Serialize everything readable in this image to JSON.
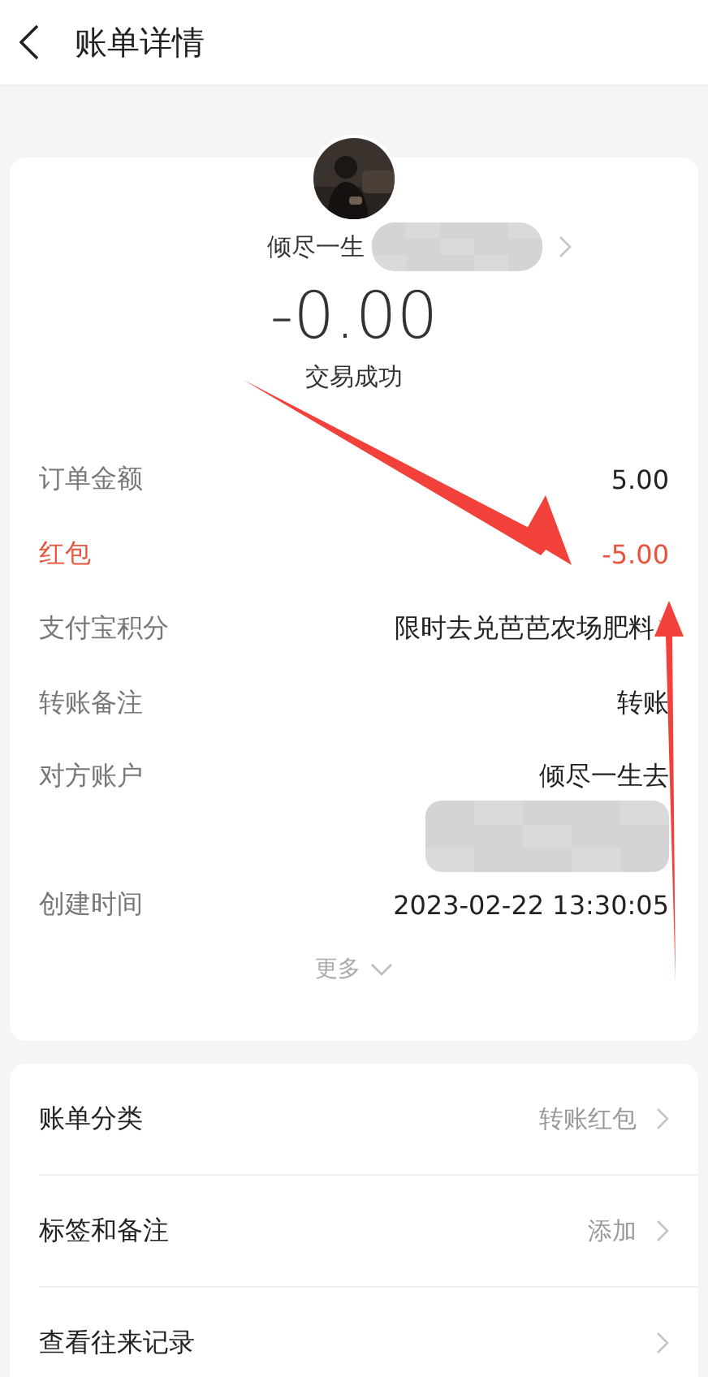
{
  "header": {
    "title": "账单详情"
  },
  "summary": {
    "payee": "倾尽一生",
    "payee_link": true,
    "amount": "-0.00",
    "status": "交易成功"
  },
  "details": [
    {
      "label": "订单金额",
      "value": "5.00",
      "kind": "plain",
      "chevron": false
    },
    {
      "label": "红包",
      "value": "-5.00",
      "kind": "discount",
      "chevron": false
    },
    {
      "label": "支付宝积分",
      "value": "限时去兑芭芭农场肥料",
      "kind": "plain",
      "chevron": true
    },
    {
      "label": "转账备注",
      "value": "转账",
      "kind": "plain",
      "chevron": false
    },
    {
      "label": "对方账户",
      "value": "倾尽一生去",
      "kind": "tall",
      "chevron": false
    },
    {
      "label": "创建时间",
      "value": "2023-02-22 13:30:05",
      "kind": "plain",
      "chevron": false
    }
  ],
  "more": "更多",
  "menu": [
    {
      "label": "账单分类",
      "value": "转账红包"
    },
    {
      "label": "标签和备注",
      "value": "添加"
    },
    {
      "label": "查看往来记录"
    }
  ],
  "annotations": [
    {
      "kind": "mosaic"
    },
    {
      "kind": "mosaic"
    },
    {
      "kind": "arrow"
    },
    {
      "kind": "arrow"
    }
  ]
}
